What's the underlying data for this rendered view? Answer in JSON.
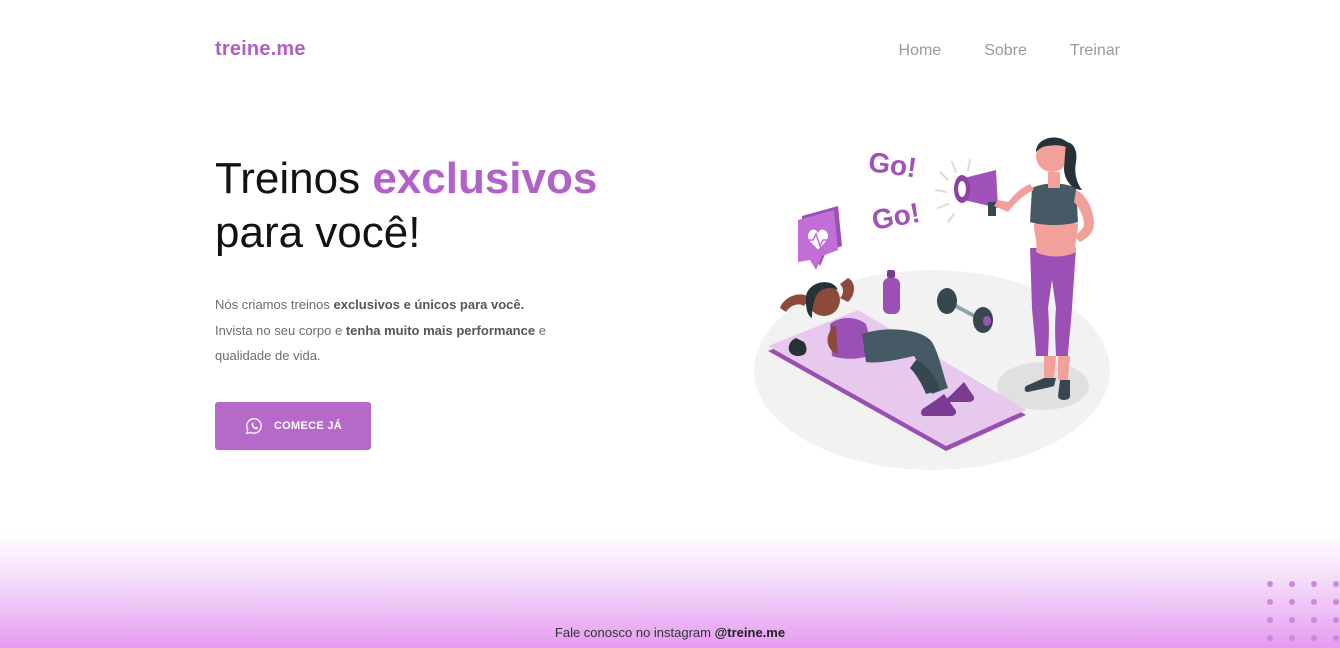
{
  "header": {
    "logo": "treine.me",
    "nav": [
      "Home",
      "Sobre",
      "Treinar"
    ]
  },
  "hero": {
    "title_part1": "Treinos ",
    "title_accent": "exclusivos",
    "title_part2": "para você!",
    "desc": {
      "l1_plain": "Nós criamos treinos ",
      "l1_bold": "exclusivos e únicos para você.",
      "l2_plain": "Invista no seu corpo e ",
      "l2_bold": "tenha muito mais performance",
      "l2_end": " e",
      "l3": "qualidade de vida."
    },
    "cta_label": "COMECE JÁ",
    "cta_icon": "whatsapp-icon"
  },
  "illustration": {
    "go1": "Go!",
    "go2": "Go!"
  },
  "footer": {
    "text": "Fale conosco no instagram ",
    "handle": "@treine.me"
  },
  "colors": {
    "accent": "#b261c8",
    "button": "#b569c8",
    "footer_gradient_end": "#e59bf2"
  }
}
